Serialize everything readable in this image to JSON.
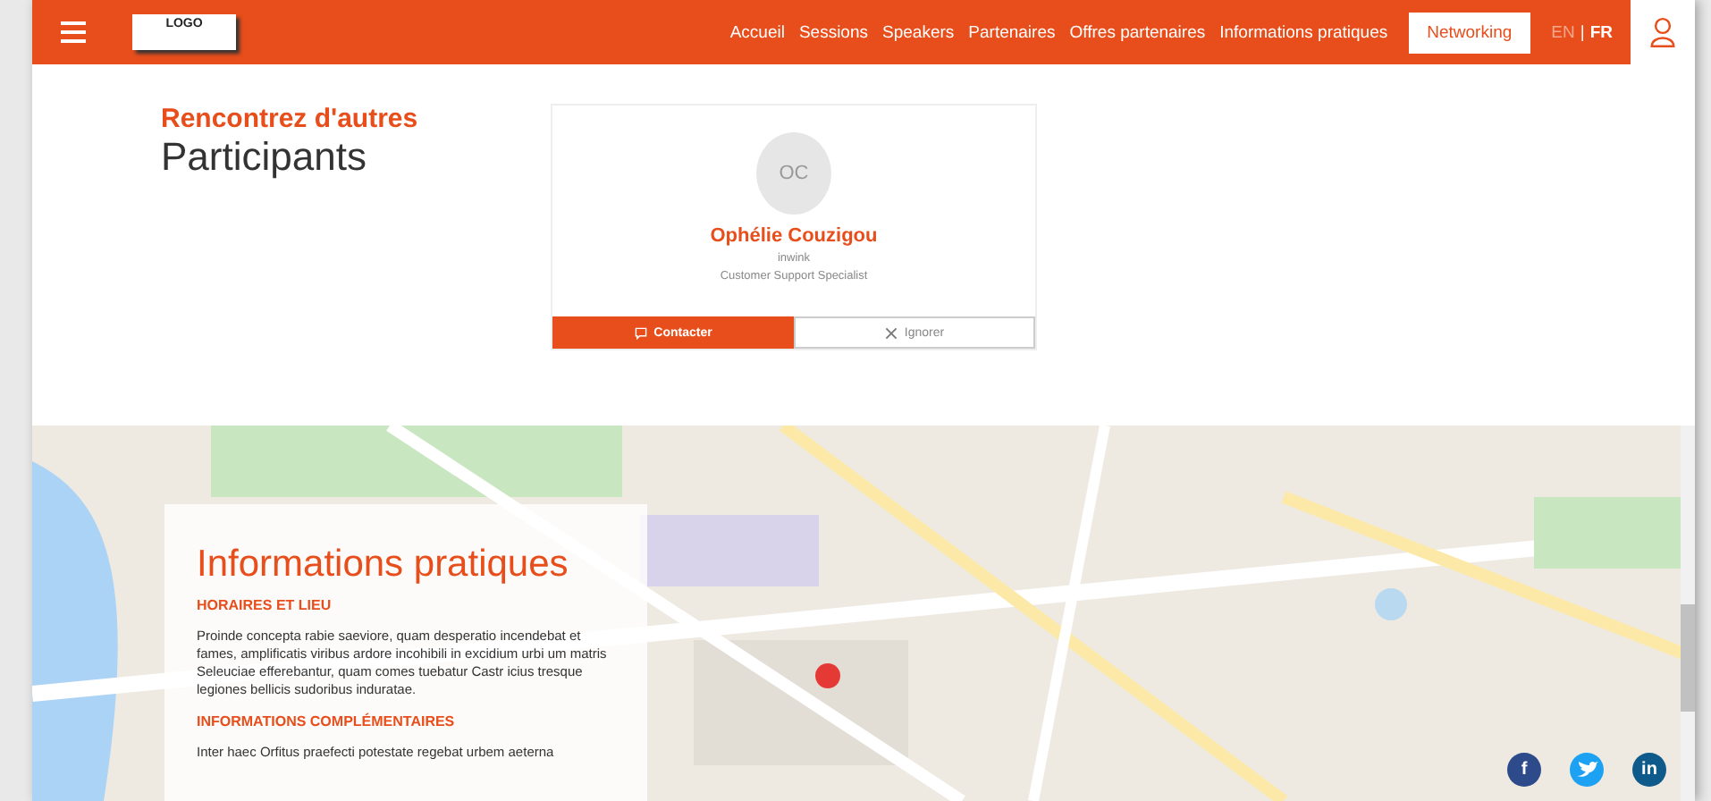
{
  "header": {
    "logo": "LOGO",
    "nav": [
      {
        "label": "Accueil",
        "selected": false
      },
      {
        "label": "Sessions",
        "selected": false
      },
      {
        "label": "Speakers",
        "selected": false
      },
      {
        "label": "Partenaires",
        "selected": false
      },
      {
        "label": "Offres partenaires",
        "selected": false
      },
      {
        "label": "Informations pratiques",
        "selected": false
      },
      {
        "label": "Networking",
        "selected": true
      }
    ],
    "languages": [
      {
        "label": "EN",
        "selected": false
      },
      {
        "label": "FR",
        "selected": true
      }
    ],
    "language_separator": "|"
  },
  "networking": {
    "title_accent": "Rencontrez d'autres",
    "title": "Participants",
    "card": {
      "initials": "OC",
      "name": "Ophélie Couzigou",
      "company": "inwink",
      "role": "Customer Support Specialist",
      "actions": [
        {
          "kind": "primary",
          "label": "Contacter"
        },
        {
          "kind": "secondary",
          "label": "Ignorer"
        }
      ]
    }
  },
  "practical_info": {
    "title": "Informations pratiques",
    "sections": [
      {
        "heading": "HORAIRES ET LIEU",
        "text": "Proinde concepta rabie saeviore, quam desperatio incendebat et fames, amplificatis viribus ardore incohibili in excidium urbi um matris Seleuciae efferebantur, quam comes tuebatur Castr icius tresque legiones bellicis sudoribus induratae."
      },
      {
        "heading": "INFORMATIONS COMPLÉMENTAIRES",
        "text": "Inter haec Orfitus praefecti potestate regebat urbem aeterna"
      }
    ],
    "social": [
      {
        "kind": "text",
        "label": "f",
        "color": "#2d4a8a"
      },
      {
        "kind": "bird",
        "color": "#1da1f2"
      },
      {
        "kind": "text",
        "label": "in",
        "color": "#0e5a8a"
      }
    ]
  }
}
